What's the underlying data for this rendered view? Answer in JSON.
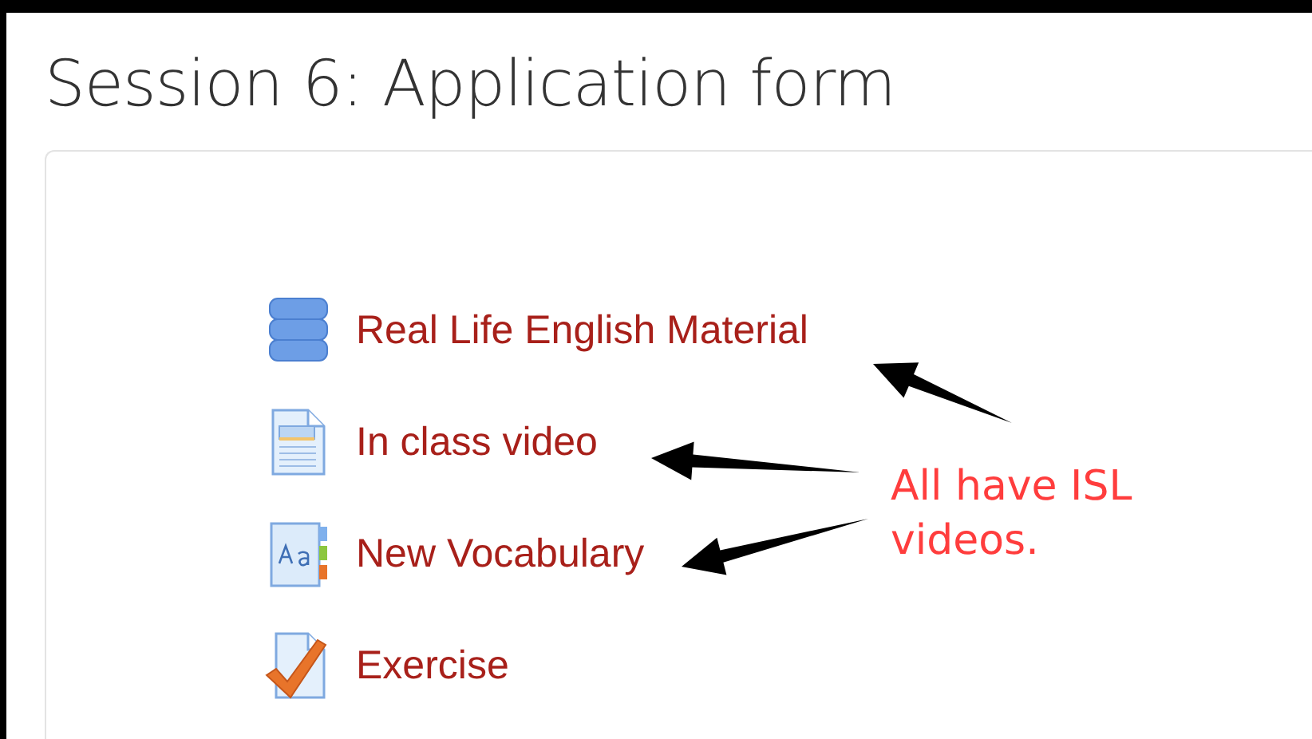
{
  "title": "Session 6: Application form",
  "activities": [
    {
      "kind": "database",
      "label": "Real Life English Material"
    },
    {
      "kind": "page",
      "label": "In class video"
    },
    {
      "kind": "glossary",
      "label": "New Vocabulary"
    },
    {
      "kind": "assignment",
      "label": "Exercise"
    }
  ],
  "annotation": {
    "note": "All have ISL videos."
  }
}
